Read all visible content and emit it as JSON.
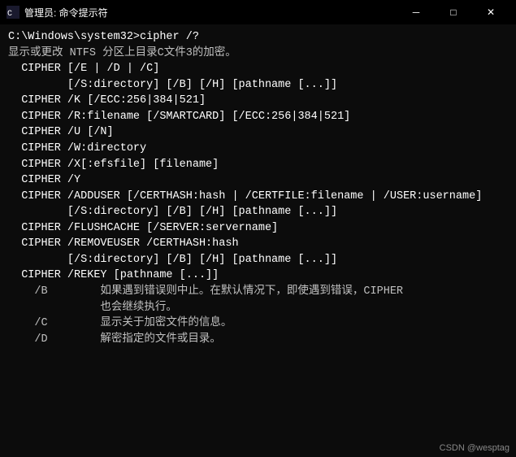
{
  "titleBar": {
    "icon": "cmd-icon",
    "title": "管理员: 命令提示符",
    "minimizeLabel": "─",
    "maximizeLabel": "□",
    "closeLabel": "✕"
  },
  "terminal": {
    "lines": [
      {
        "text": "C:\\Windows\\system32>cipher /?",
        "bright": true
      },
      {
        "text": "显示或更改 NTFS 分区上目录C文件3的加密。",
        "bright": false
      },
      {
        "text": "",
        "bright": false
      },
      {
        "text": "  CIPHER [/E | /D | /C]",
        "bright": true
      },
      {
        "text": "         [/S:directory] [/B] [/H] [pathname [...]]",
        "bright": true
      },
      {
        "text": "",
        "bright": false
      },
      {
        "text": "  CIPHER /K [/ECC:256|384|521]",
        "bright": true
      },
      {
        "text": "",
        "bright": false
      },
      {
        "text": "  CIPHER /R:filename [/SMARTCARD] [/ECC:256|384|521]",
        "bright": true
      },
      {
        "text": "",
        "bright": false
      },
      {
        "text": "  CIPHER /U [/N]",
        "bright": true
      },
      {
        "text": "",
        "bright": false
      },
      {
        "text": "  CIPHER /W:directory",
        "bright": true
      },
      {
        "text": "",
        "bright": false
      },
      {
        "text": "  CIPHER /X[:efsfile] [filename]",
        "bright": true
      },
      {
        "text": "",
        "bright": false
      },
      {
        "text": "  CIPHER /Y",
        "bright": true
      },
      {
        "text": "",
        "bright": false
      },
      {
        "text": "  CIPHER /ADDUSER [/CERTHASH:hash | /CERTFILE:filename | /USER:username]",
        "bright": true
      },
      {
        "text": "         [/S:directory] [/B] [/H] [pathname [...]]",
        "bright": true
      },
      {
        "text": "",
        "bright": false
      },
      {
        "text": "  CIPHER /FLUSHCACHE [/SERVER:servername]",
        "bright": true
      },
      {
        "text": "",
        "bright": false
      },
      {
        "text": "  CIPHER /REMOVEUSER /CERTHASH:hash",
        "bright": true
      },
      {
        "text": "         [/S:directory] [/B] [/H] [pathname [...]]",
        "bright": true
      },
      {
        "text": "",
        "bright": false
      },
      {
        "text": "  CIPHER /REKEY [pathname [...]]",
        "bright": true
      },
      {
        "text": "",
        "bright": false
      },
      {
        "text": "    /B        如果遇到错误则中止。在默认情况下，即使遇到错误，CIPHER",
        "bright": false
      },
      {
        "text": "              也会继续执行。",
        "bright": false
      },
      {
        "text": "    /C        显示关于加密文件的信息。",
        "bright": false
      },
      {
        "text": "    /D        解密指定的文件或目录。",
        "bright": false
      }
    ]
  },
  "footer": {
    "text": "CSDN @wesptag"
  }
}
